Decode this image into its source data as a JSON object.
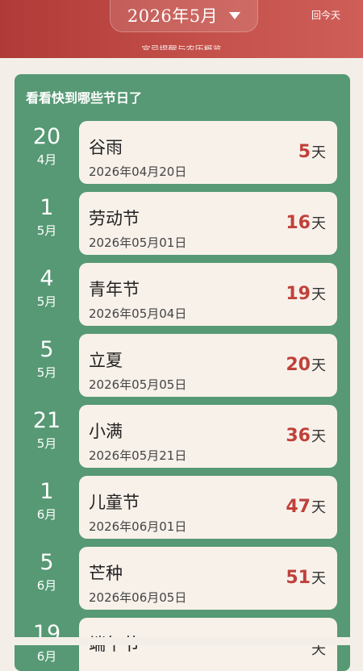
{
  "header": {
    "month_label": "2026年5月",
    "today_label": "回今天",
    "cut_text": "宜忌提醒与农历概览",
    "icons": {
      "caret": "caret-down-icon"
    },
    "colors": {
      "header": "#b8423e",
      "panel": "#569974",
      "accent": "#c0413b"
    }
  },
  "holidays": {
    "title": "看看快到哪些节日了",
    "unit": "天",
    "items": [
      {
        "day": "20",
        "month": "4月",
        "name": "谷雨",
        "date": "2026年04月20日",
        "days": "5"
      },
      {
        "day": "1",
        "month": "5月",
        "name": "劳动节",
        "date": "2026年05月01日",
        "days": "16"
      },
      {
        "day": "4",
        "month": "5月",
        "name": "青年节",
        "date": "2026年05月04日",
        "days": "19"
      },
      {
        "day": "5",
        "month": "5月",
        "name": "立夏",
        "date": "2026年05月05日",
        "days": "20"
      },
      {
        "day": "21",
        "month": "5月",
        "name": "小满",
        "date": "2026年05月21日",
        "days": "36"
      },
      {
        "day": "1",
        "month": "6月",
        "name": "儿童节",
        "date": "2026年06月01日",
        "days": "47"
      },
      {
        "day": "5",
        "month": "6月",
        "name": "芒种",
        "date": "2026年06月05日",
        "days": "51"
      },
      {
        "day": "19",
        "month": "6月",
        "name": "端午节",
        "date": "",
        "days": ""
      }
    ]
  }
}
